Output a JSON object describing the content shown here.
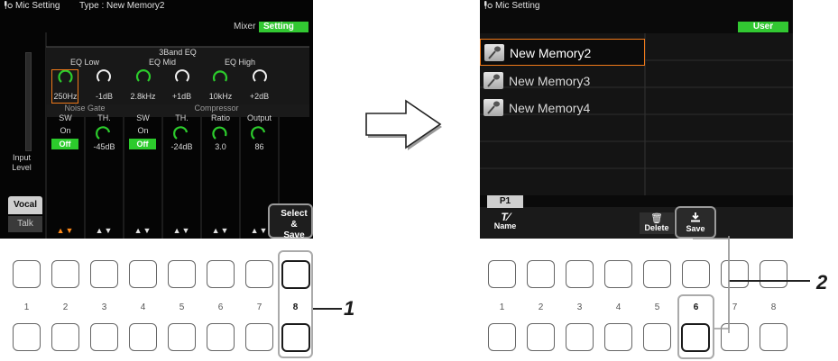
{
  "left_screen": {
    "title": "Mic Setting",
    "type_text": "Type : New Memory2",
    "tabs": [
      {
        "label": "Mixer"
      },
      {
        "label": "Setting"
      }
    ],
    "eq_header": "3Band EQ",
    "eq_groups": [
      {
        "label": "EQ Low"
      },
      {
        "label": "EQ Mid"
      },
      {
        "label": "EQ High"
      }
    ],
    "eq_values": [
      "250Hz",
      "-1dB",
      "2.8kHz",
      "+1dB",
      "10kHz",
      "+2dB"
    ],
    "noise_gate_label": "Noise Gate",
    "compressor_label": "Compressor",
    "param_labels": [
      "SW",
      "TH.",
      "SW",
      "TH.",
      "Ratio",
      "Output"
    ],
    "param_values": [
      "-45dB",
      "-24dB",
      "3.0",
      "86"
    ],
    "sw_states": [
      {
        "status": "On",
        "button": "Off"
      },
      {
        "status": "On",
        "button": "Off"
      }
    ],
    "input_level_label": "Input\nLevel",
    "side_tabs": [
      {
        "label": "Vocal"
      },
      {
        "label": "Talk"
      }
    ],
    "bottom_arrows": [
      "▲▼",
      "▲▼",
      "▲▼",
      "▲▼",
      "▲▼",
      "▲▼"
    ],
    "select_save_label": "Select &\nSave"
  },
  "right_screen": {
    "title": "Mic Setting",
    "user_tab": "User",
    "items": [
      {
        "label": "New Memory2",
        "selected": true
      },
      {
        "label": "New Memory3",
        "selected": false
      },
      {
        "label": "New Memory4",
        "selected": false
      }
    ],
    "page_label": "P1",
    "name_button": "Name",
    "delete_button": "Delete",
    "save_button": "Save"
  },
  "hardware_left": {
    "numbers": [
      "1",
      "2",
      "3",
      "4",
      "5",
      "6",
      "7",
      "8"
    ]
  },
  "hardware_right": {
    "numbers": [
      "1",
      "2",
      "3",
      "4",
      "5",
      "6",
      "7",
      "8"
    ]
  },
  "callouts": {
    "one": "1",
    "two": "2"
  },
  "colors": {
    "accent_green": "#2ccb2c",
    "selection_orange": "#f07a1a",
    "screen_bg": "#050505"
  }
}
